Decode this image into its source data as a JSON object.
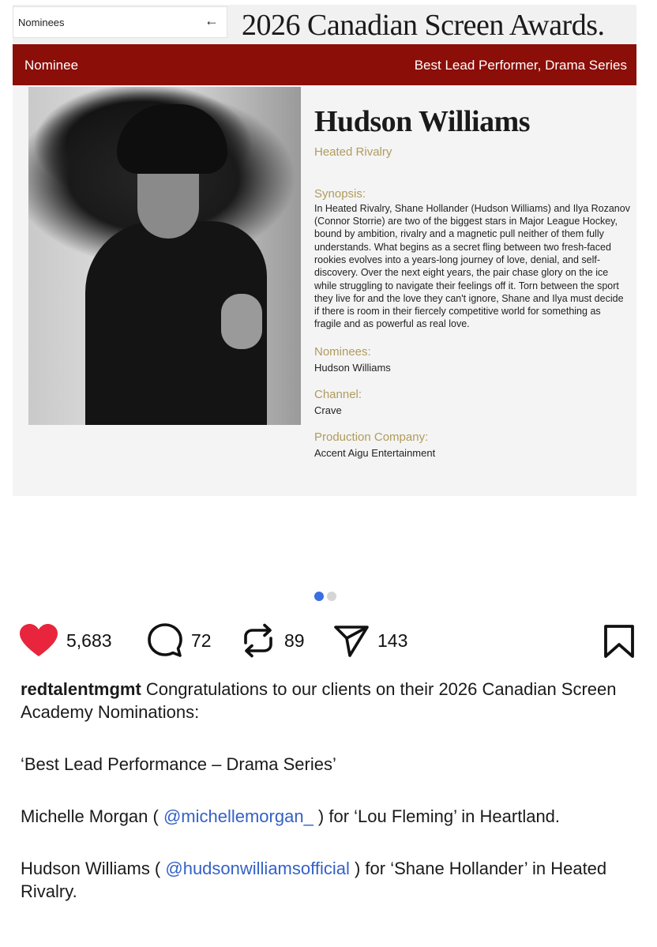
{
  "post_image": {
    "dropdown": {
      "label": "Nominees",
      "arrow": "←"
    },
    "awards_title": "2026 Canadian Screen Awards.",
    "category_bar": {
      "left": "Nominee",
      "right": "Best Lead Performer, Drama Series"
    },
    "person_name": "Hudson Williams",
    "show": "Heated Rivalry",
    "synopsis_heading": "Synopsis:",
    "synopsis_text": "In Heated Rivalry, Shane Hollander (Hudson Williams) and Ilya Rozanov (Connor Storrie) are two of the biggest stars in Major League Hockey, bound by ambition, rivalry and a magnetic pull neither of them fully understands. What begins as a secret fling between two fresh-faced rookies evolves into a years-long journey of love, denial, and self-discovery. Over the next eight years, the pair chase glory on the ice while struggling to navigate their feelings off it. Torn between the sport they live for and the love they can't ignore, Shane and Ilya must decide if there is room in their fiercely competitive world for something as fragile and as powerful as real love.",
    "nominees_heading": "Nominees:",
    "nominees_value": "Hudson Williams",
    "channel_heading": "Channel:",
    "channel_value": "Crave",
    "production_heading": "Production Company:",
    "production_value": "Accent Aigu Entertainment"
  },
  "carousel": {
    "current": 1,
    "total": 2
  },
  "actions": {
    "likes": "5,683",
    "comments": "72",
    "reposts": "89",
    "shares": "143"
  },
  "colors": {
    "like": "#e8253c",
    "accent_red": "#8b0e08",
    "gold": "#b09b5e",
    "mention": "#3461c6"
  },
  "caption": {
    "username": "redtalentmgmt",
    "intro": " Congratulations to our clients on their 2026 Canadian Screen Academy Nominations:",
    "category": "‘Best Lead Performance – Drama Series’",
    "line1_pre": "Michelle Morgan ( ",
    "line1_mention": "@michellemorgan_",
    "line1_post": " ) for ‘Lou Fleming’ in Heartland.",
    "line2_pre": "Hudson Williams ( ",
    "line2_mention": "@hudsonwilliamsofficial",
    "line2_post": " ) for ‘Shane Hollander’ in Heated Rivalry."
  }
}
